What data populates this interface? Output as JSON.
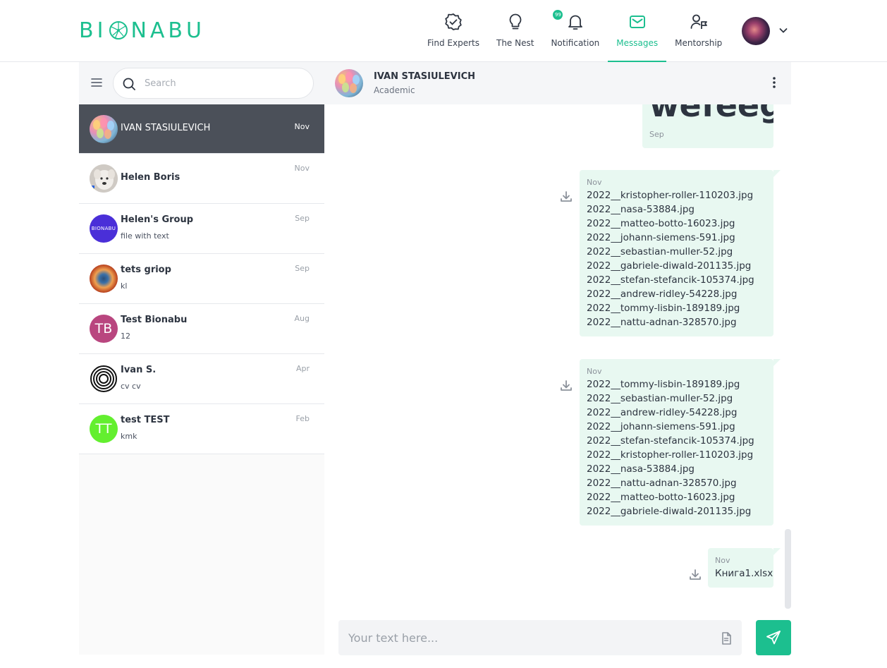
{
  "brand": {
    "logo_left": "BI",
    "logo_right": "NABU",
    "accent": "#1cbf8f"
  },
  "nav": {
    "items": [
      {
        "label": "Find Experts",
        "icon": "verified-check-icon"
      },
      {
        "label": "The Nest",
        "icon": "lightbulb-icon"
      },
      {
        "label": "Notification",
        "icon": "bell-icon",
        "badge": "99"
      },
      {
        "label": "Messages",
        "icon": "envelope-icon",
        "active": true
      },
      {
        "label": "Mentorship",
        "icon": "mentor-flag-icon"
      }
    ]
  },
  "search": {
    "placeholder": "Search"
  },
  "conversations": [
    {
      "name": "IVAN STASIULEVICH",
      "preview": "",
      "date": "Nov",
      "active": true
    },
    {
      "name": "Helen Boris",
      "preview": "",
      "date": "Nov"
    },
    {
      "name": "Helen's Group",
      "preview": "file with text",
      "date": "Sep",
      "avatar_text": "BIONABU"
    },
    {
      "name": "tets griop",
      "preview": "kl",
      "date": "Sep"
    },
    {
      "name": "Test Bionabu",
      "preview": "12",
      "date": "Aug",
      "initials": "TB",
      "avatar_color": "#b9467f"
    },
    {
      "name": "Ivan S.",
      "preview": "cv cv",
      "date": "Apr"
    },
    {
      "name": "test TEST",
      "preview": "kmk",
      "date": "Feb",
      "initials": "TT",
      "avatar_color": "#63ef2f"
    }
  ],
  "chat": {
    "contact_name": "IVAN STASIULEVICH",
    "contact_role": "Academic",
    "messages": [
      {
        "text": "wefeeg",
        "date": "Sep"
      },
      {
        "date": "Nov",
        "files": [
          "2022__kristopher-roller-110203.jpg",
          "2022__nasa-53884.jpg",
          "2022__matteo-botto-16023.jpg",
          "2022__johann-siemens-591.jpg",
          "2022__sebastian-muller-52.jpg",
          "2022__gabriele-diwald-201135.jpg",
          "2022__stefan-stefancik-105374.jpg",
          "2022__andrew-ridley-54228.jpg",
          "2022__tommy-lisbin-189189.jpg",
          "2022__nattu-adnan-328570.jpg"
        ]
      },
      {
        "date": "Nov",
        "files": [
          "2022__tommy-lisbin-189189.jpg",
          "2022__sebastian-muller-52.jpg",
          "2022__andrew-ridley-54228.jpg",
          "2022__johann-siemens-591.jpg",
          "2022__stefan-stefancik-105374.jpg",
          "2022__kristopher-roller-110203.jpg",
          "2022__nasa-53884.jpg",
          "2022__nattu-adnan-328570.jpg",
          "2022__matteo-botto-16023.jpg",
          "2022__gabriele-diwald-201135.jpg"
        ]
      },
      {
        "date": "Nov",
        "files": [
          "Книга1.xlsx"
        ]
      }
    ],
    "composer_placeholder": "Your text here..."
  }
}
